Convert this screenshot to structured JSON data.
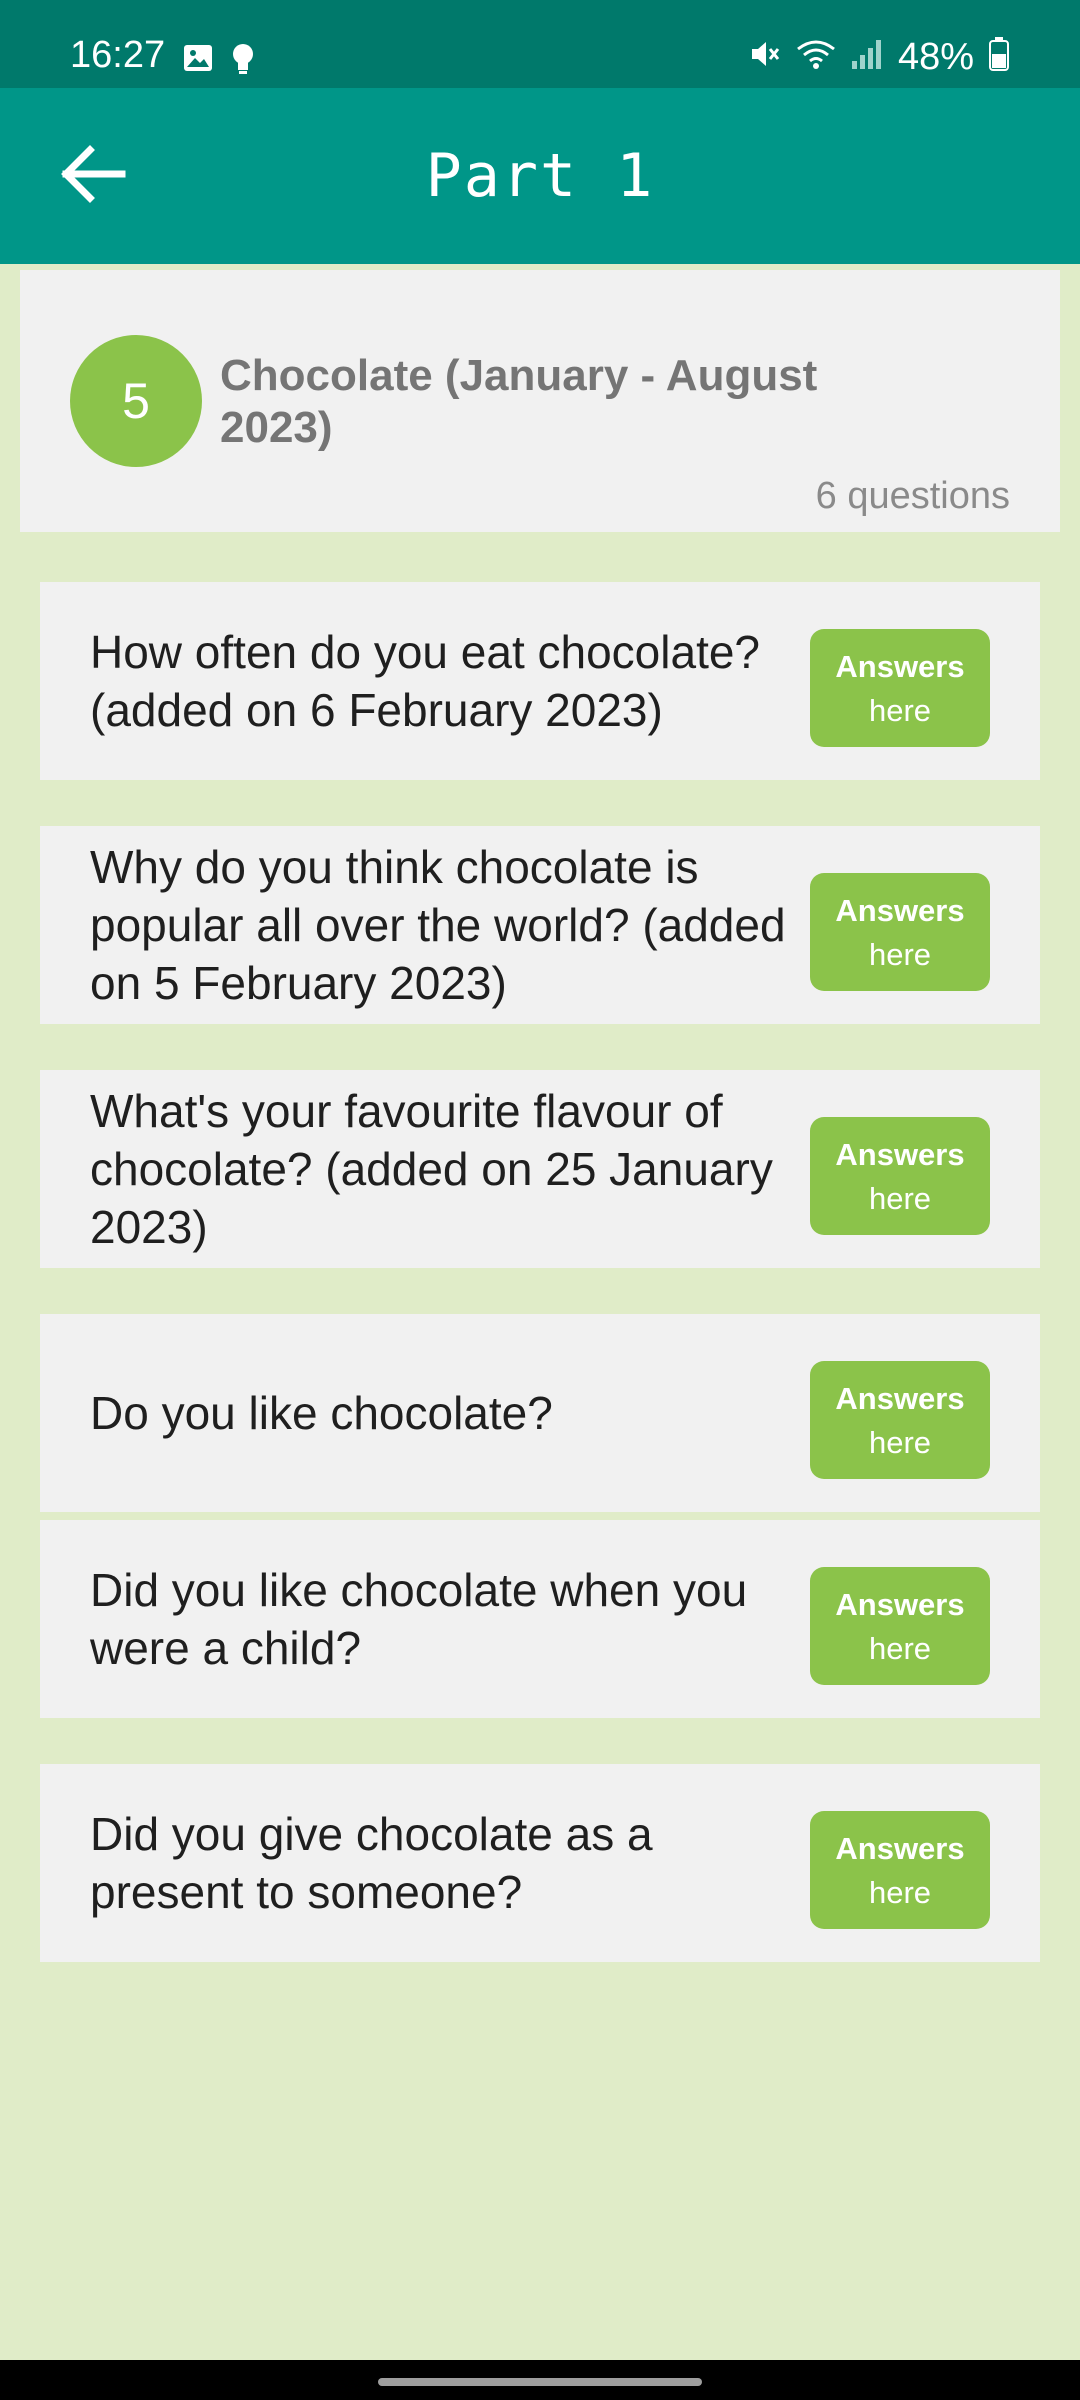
{
  "status_bar": {
    "time": "16:27",
    "battery": "48%",
    "icons": [
      "image-icon",
      "bulb-icon",
      "mute-icon",
      "wifi-icon",
      "signal-icon",
      "battery-icon"
    ]
  },
  "app_bar": {
    "title": "Part 1",
    "back_icon": "arrow-left-icon"
  },
  "topic": {
    "number": "5",
    "title": "Chocolate (January - August 2023)",
    "question_count": "6 questions"
  },
  "questions": [
    {
      "text": "How often do you eat chocolate? (added on 6 February 2023)",
      "button_line1": "Answers",
      "button_line2": "here"
    },
    {
      "text": "Why do you think chocolate is popular all over the world? (added on 5 February 2023)",
      "button_line1": "Answers",
      "button_line2": "here"
    },
    {
      "text": "What's your favourite flavour of chocolate? (added on 25 January 2023)",
      "button_line1": "Answers",
      "button_line2": "here"
    },
    {
      "text": "Do you like chocolate?",
      "button_line1": "Answers",
      "button_line2": "here"
    },
    {
      "text": "Did you like chocolate when you were a child?",
      "button_line1": "Answers",
      "button_line2": "here"
    },
    {
      "text": "Did you give chocolate as a present to someone?",
      "button_line1": "Answers",
      "button_line2": "here"
    }
  ],
  "colors": {
    "status_bar": "#00796b",
    "app_bar": "#009688",
    "accent_green": "#8bc34a",
    "background": "#e0ecc8",
    "card": "#f1f1f1"
  }
}
